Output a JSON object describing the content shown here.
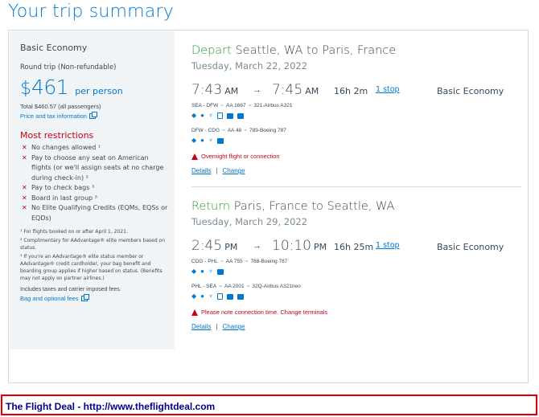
{
  "page_title": "Your trip summary",
  "summary": {
    "fare_type": "Basic Economy",
    "trip_type": "Round trip (Non-refundable)",
    "currency": "$",
    "price": "461",
    "per_person": "per person",
    "total": "Total $460.57 (all passengers)",
    "price_tax_link": "Price and tax information",
    "restrictions_title": "Most restrictions",
    "restrictions": [
      "No changes allowed ¹",
      "Pay to choose any seat on American flights (or we'll assign seats at no charge during check-in) ²",
      "Pay to check bags ³",
      "Board in last group ³",
      "No Elite Qualifying Credits (EQMs, EQSs or EQDs)"
    ],
    "footnotes": [
      "¹ For flights booked on or after April 1, 2021.",
      "² Complimentary for AAdvantage® elite members based on status.",
      "³ If you're an AAdvantage® elite status member or AAdvantage® credit cardholder, your bag benefit and boarding group applies if higher based on status. (Benefits may not apply on partner airlines.)"
    ],
    "taxes_note": "Includes taxes and carrier imposed fees.",
    "bag_fees_link": "Bag and optional fees"
  },
  "depart": {
    "direction": "Depart",
    "route": "Seattle, WA to Paris, France",
    "date": "Tuesday, March 22, 2022",
    "dep_time": "7:43",
    "dep_ampm": "AM",
    "arrow": "→",
    "arr_time": "7:45",
    "arr_ampm": "AM",
    "duration": "16h  2m",
    "stops": "1 stop",
    "cabin": "Basic Economy",
    "legs": [
      {
        "route": "SEA - DFW",
        "flight": "AA 1667",
        "aircraft": "321-Airbus A321"
      },
      {
        "route": "DFW - CDG",
        "flight": "AA 48",
        "aircraft": "789-Boeing 787"
      }
    ],
    "warning": "Overnight flight or connection",
    "details_link": "Details",
    "change_link": "Change",
    "separator": "|"
  },
  "return": {
    "direction": "Return",
    "route": "Paris, France to Seattle, WA",
    "date": "Tuesday, March 29, 2022",
    "dep_time": "2:45",
    "dep_ampm": "PM",
    "arrow": "→",
    "arr_time": "10:10",
    "arr_ampm": "PM",
    "duration": "16h  25m",
    "stops": "1 stop",
    "cabin": "Basic Economy",
    "legs": [
      {
        "route": "CDG - PHL",
        "flight": "AA 755",
        "aircraft": "788-Boeing 787"
      },
      {
        "route": "PHL - SEA",
        "flight": "AA 2001",
        "aircraft": "32Q-Airbus A321neo"
      }
    ],
    "warning": "Please note connection time. Change terminals",
    "details_link": "Details",
    "change_link": "Change",
    "separator": "|"
  },
  "leg_separator": "=",
  "banner": "The Flight Deal - http://www.theflightdeal.com",
  "colors": {
    "accent": "#0078d2",
    "depart_green": "#2a9b2a",
    "restriction_red": "#c30019",
    "banner_border": "#e00000",
    "banner_text": "#00008b"
  }
}
